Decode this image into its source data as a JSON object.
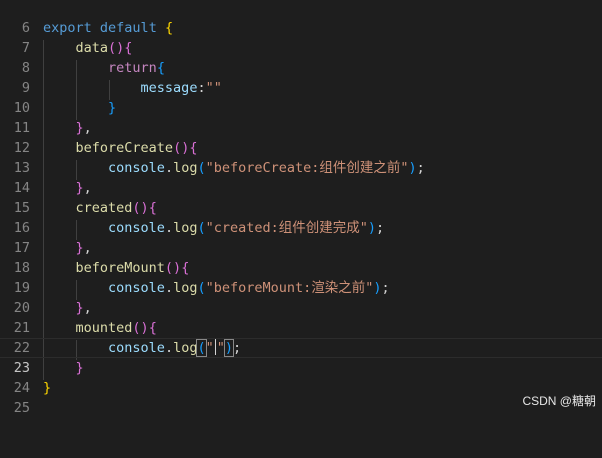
{
  "gutter": [
    "6",
    "7",
    "8",
    "9",
    "10",
    "11",
    "12",
    "13",
    "14",
    "15",
    "16",
    "17",
    "18",
    "19",
    "20",
    "21",
    "22",
    "23",
    "24",
    "25"
  ],
  "code": {
    "l7": {
      "export": "export",
      "default": "default",
      "brace": "{"
    },
    "l8": {
      "name": "data",
      "parens": "()",
      "brace": "{"
    },
    "l9": {
      "ret": "return",
      "brace": "{"
    },
    "l10": {
      "key": "message",
      "colon": ":",
      "value": "\"\""
    },
    "l11": {
      "brace": "}"
    },
    "l12": {
      "brace": "}",
      "comma": ","
    },
    "l13": {
      "name": "beforeCreate",
      "parens": "()",
      "brace": "{"
    },
    "l14": {
      "obj": "console",
      "dot": ".",
      "method": "log",
      "open": "(",
      "str": "\"beforeCreate:组件创建之前\"",
      "close": ")",
      "semi": ";"
    },
    "l15": {
      "brace": "}",
      "comma": ","
    },
    "l16": {
      "name": "created",
      "parens": "()",
      "brace": "{"
    },
    "l17": {
      "obj": "console",
      "dot": ".",
      "method": "log",
      "open": "(",
      "str": "\"created:组件创建完成\"",
      "close": ")",
      "semi": ";"
    },
    "l18": {
      "brace": "}",
      "comma": ","
    },
    "l19": {
      "name": "beforeMount",
      "parens": "()",
      "brace": "{"
    },
    "l20": {
      "obj": "console",
      "dot": ".",
      "method": "log",
      "open": "(",
      "str": "\"beforeMount:渲染之前\"",
      "close": ")",
      "semi": ";"
    },
    "l21": {
      "brace": "}",
      "comma": ","
    },
    "l22": {
      "name": "mounted",
      "parens": "()",
      "brace": "{"
    },
    "l23": {
      "obj": "console",
      "dot": ".",
      "method": "log",
      "open": "(",
      "q1": "\"",
      "q2": "\"",
      "close": ")",
      "semi": ";"
    },
    "l24": {
      "brace": "}"
    },
    "l25": {
      "brace": "}"
    }
  },
  "watermark": "CSDN @糖朝",
  "colors": {
    "background": "#1e1e1e",
    "keyword": "#569cd6",
    "control_keyword": "#c586c0",
    "function": "#dcdcaa",
    "property": "#9cdcfe",
    "string": "#ce9178",
    "bracket_level_1": "#ffd700",
    "bracket_level_2": "#da70d6",
    "bracket_level_3": "#179fff",
    "line_number": "#858585"
  }
}
